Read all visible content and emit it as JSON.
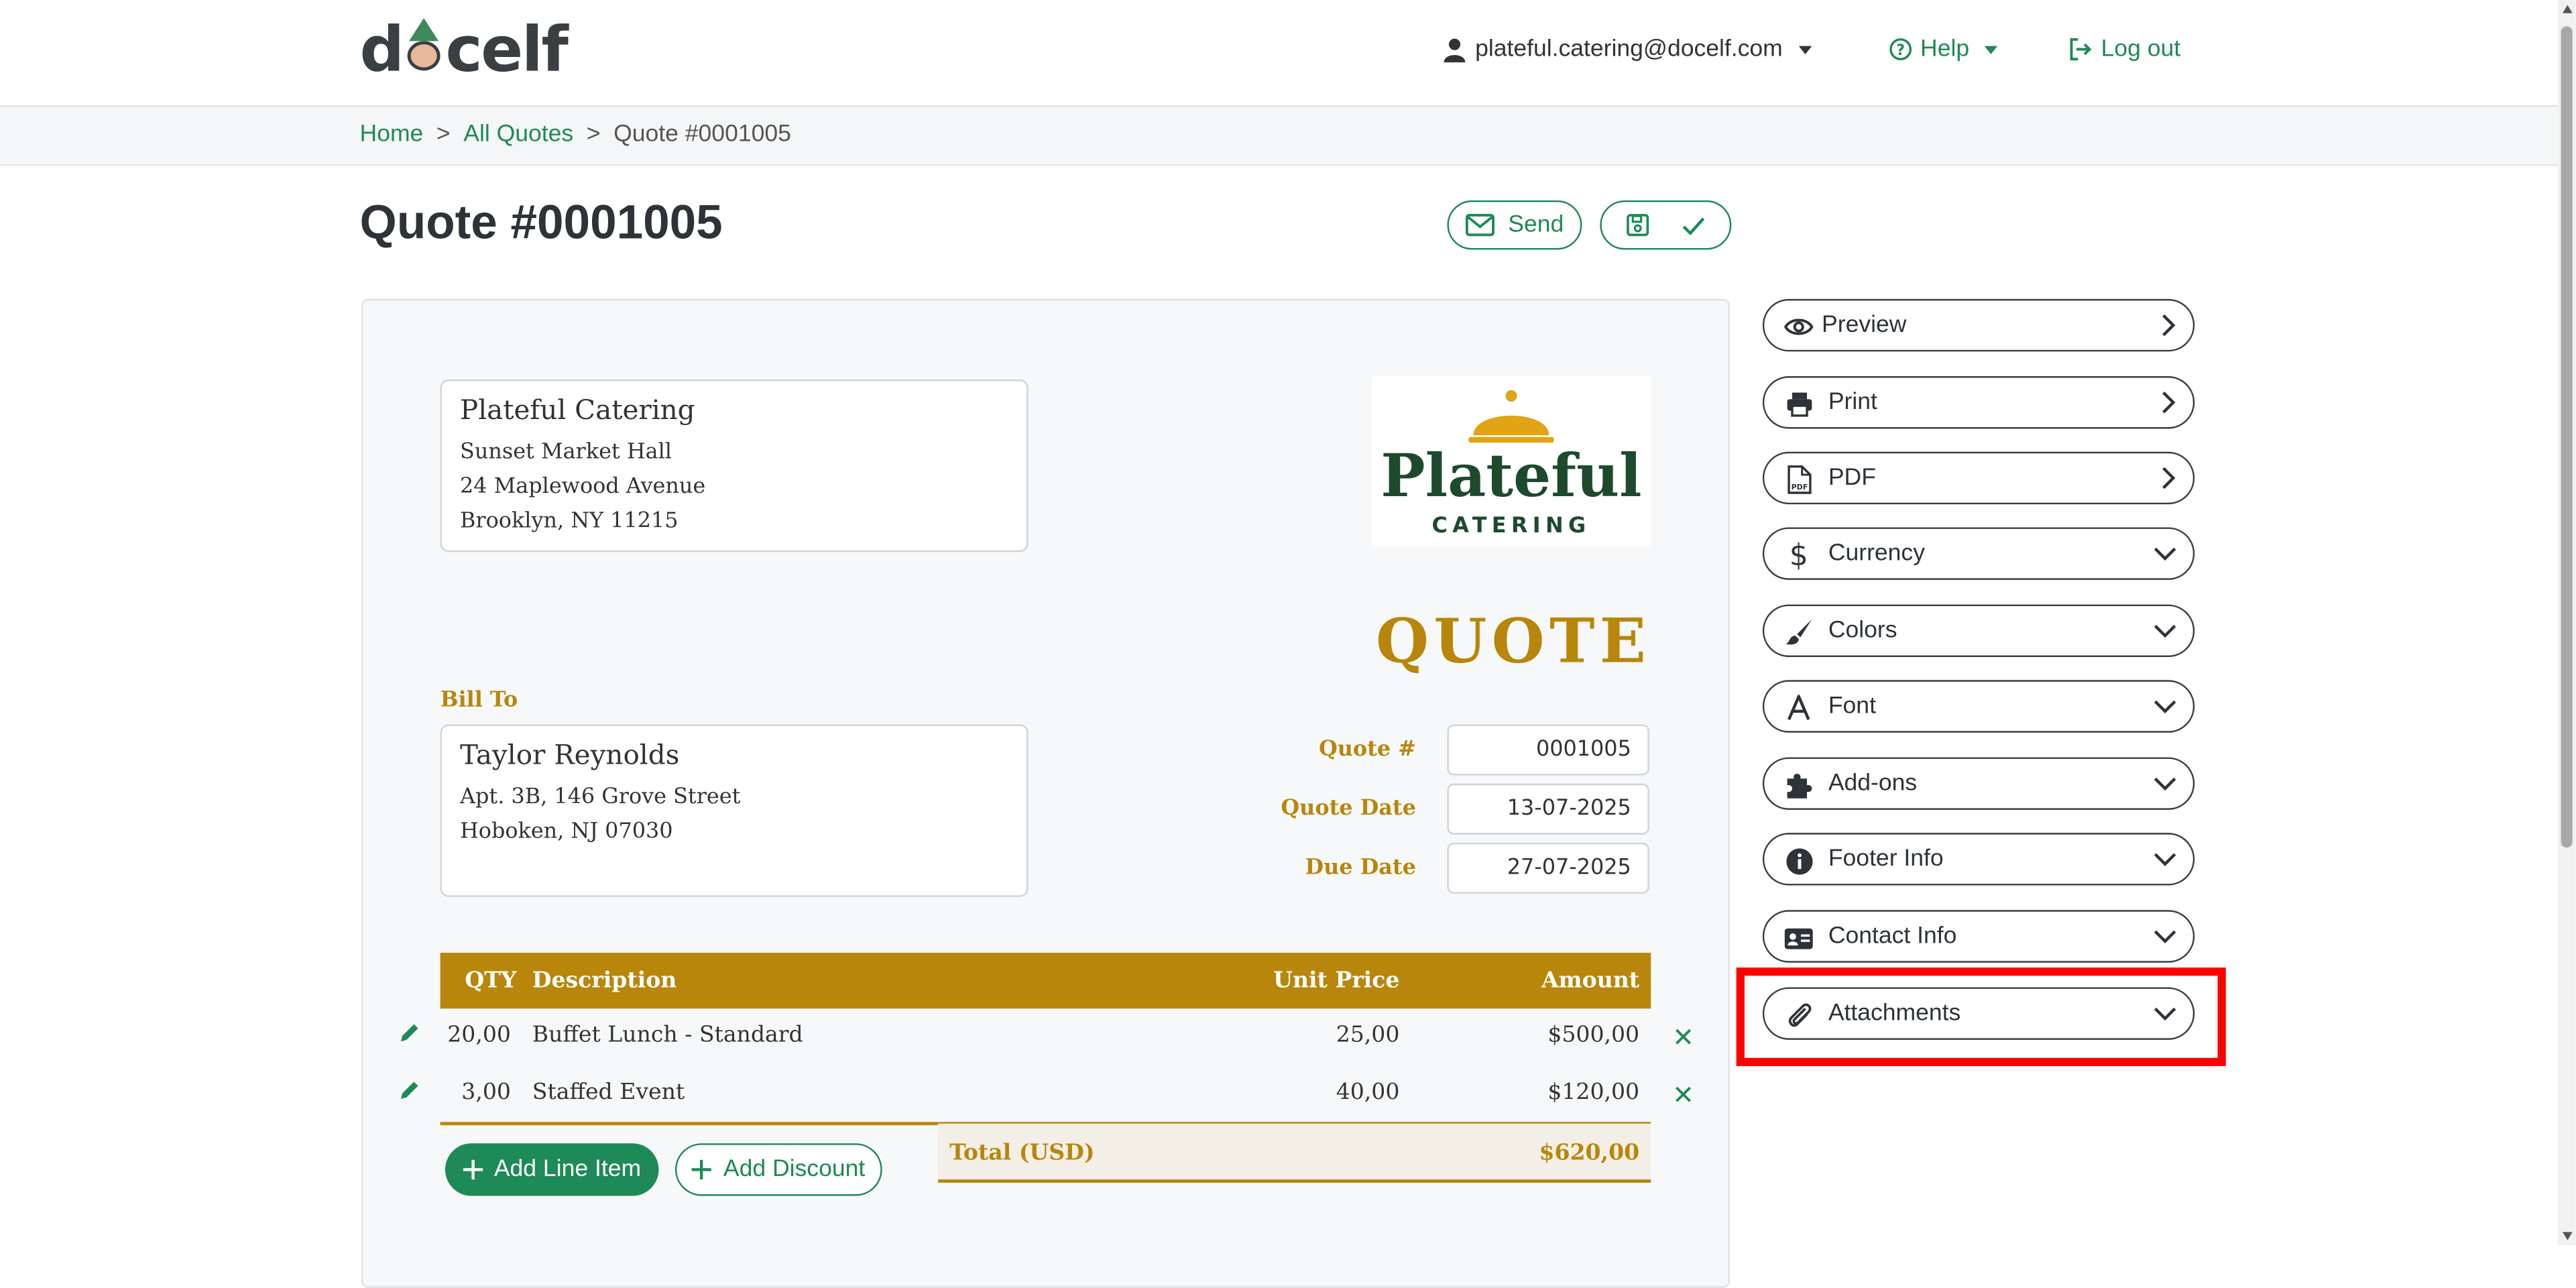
{
  "header": {
    "logo": "docelf",
    "user_email": "plateful.catering@docelf.com",
    "help": "Help",
    "logout": "Log out"
  },
  "breadcrumb": {
    "home": "Home",
    "all_quotes": "All Quotes",
    "current": "Quote #0001005",
    "separator": ">"
  },
  "page": {
    "title": "Quote #0001005",
    "send_label": "Send"
  },
  "document": {
    "from": {
      "name": "Plateful Catering",
      "line1": "Sunset Market Hall",
      "line2": "24 Maplewood Avenue",
      "line3": "Brooklyn, NY 11215"
    },
    "logo": {
      "word": "Plateful",
      "sub": "CATERING"
    },
    "heading": "QUOTE",
    "bill_to_label": "Bill To",
    "to": {
      "name": "Taylor Reynolds",
      "line1": "Apt. 3B, 146 Grove Street",
      "line2": "Hoboken, NJ 07030"
    },
    "meta": {
      "quote_no_label": "Quote #",
      "quote_no": "0001005",
      "quote_date_label": "Quote Date",
      "quote_date": "13-07-2025",
      "due_date_label": "Due Date",
      "due_date": "27-07-2025"
    },
    "columns": {
      "qty": "QTY",
      "desc": "Description",
      "unit": "Unit Price",
      "amount": "Amount"
    },
    "items": [
      {
        "qty": "20,00",
        "desc": "Buffet Lunch - Standard",
        "unit": "25,00",
        "amount": "$500,00"
      },
      {
        "qty": "3,00",
        "desc": "Staffed Event",
        "unit": "40,00",
        "amount": "$120,00"
      }
    ],
    "total_label": "Total (USD)",
    "total": "$620,00",
    "add_line_item": "Add Line Item",
    "add_discount": "Add Discount"
  },
  "sidebar": {
    "preview": "Preview",
    "print": "Print",
    "pdf": "PDF",
    "currency": "Currency",
    "colors": "Colors",
    "font": "Font",
    "addons": "Add-ons",
    "footer": "Footer Info",
    "contact": "Contact Info",
    "attachments": "Attachments"
  },
  "theme": {
    "accent": "#1e8a57",
    "doc_gold": "#b8860b",
    "highlight": "#ff0000"
  }
}
